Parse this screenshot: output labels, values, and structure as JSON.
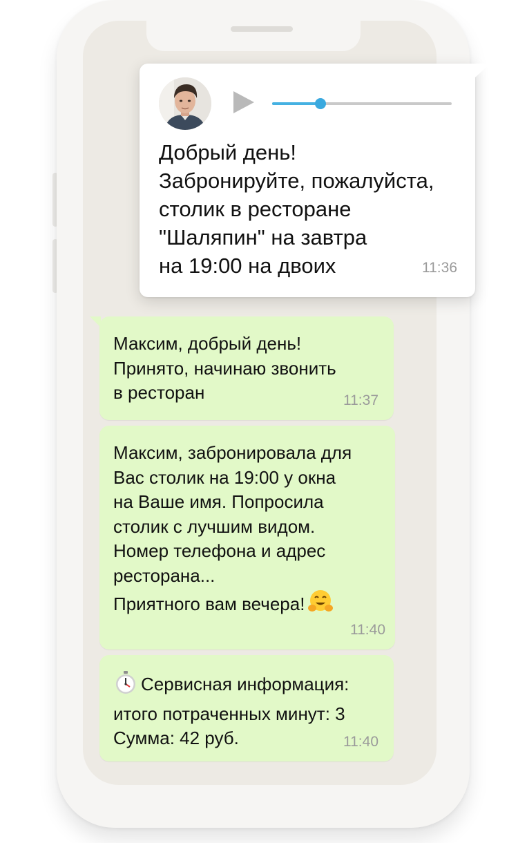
{
  "voice_message": {
    "progress": 0.27,
    "text_lines": [
      "Добрый день!",
      "Забронируйте, пожалуйста,",
      "столик в ресторане",
      "\"Шаляпин\" на завтра",
      "на 19:00 на двоих"
    ],
    "time": "11:36"
  },
  "messages": [
    {
      "lines": [
        "Максим, добрый день!",
        "Принято, начинаю звонить",
        "в ресторан"
      ],
      "time": "11:37"
    },
    {
      "lines": [
        "Максим, забронировала для",
        "Вас столик на 19:00 у окна",
        "на Ваше имя. Попросила",
        "столик с лучшим видом.",
        "Номер телефона и адрес",
        "ресторана...",
        "Приятного вам вечера!"
      ],
      "emoji": "hugging-face-icon",
      "time": "11:40"
    },
    {
      "icon": "stopwatch-icon",
      "lines": [
        "Сервисная информация:",
        "итого потраченных минут: 3",
        "Сумма: 42 руб."
      ],
      "time": "11:40"
    }
  ],
  "colors": {
    "screen_bg": "#edeae4",
    "incoming_bubble": "#e2f9c8",
    "outgoing_bubble": "#ffffff",
    "progress_accent": "#45b1e2",
    "timestamp": "#9a9a9a"
  }
}
